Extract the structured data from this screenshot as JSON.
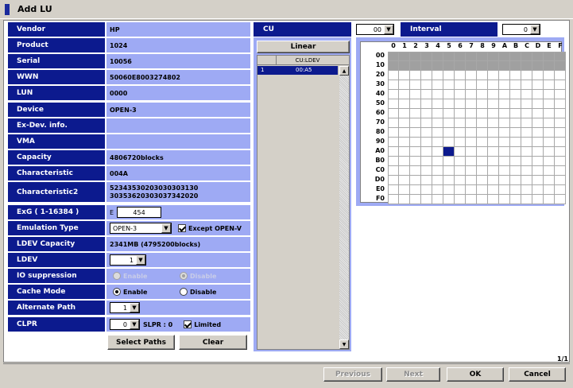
{
  "window": {
    "title": "Add LU"
  },
  "properties": [
    {
      "label": "Vendor",
      "value": "HP"
    },
    {
      "label": "Product",
      "value": "1024"
    },
    {
      "label": "Serial",
      "value": "10056"
    },
    {
      "label": "WWN",
      "value": "50060E8003274802"
    },
    {
      "label": "LUN",
      "value": "0000"
    },
    {
      "label": "Device",
      "value": "OPEN-3"
    },
    {
      "label": "Ex-Dev. info.",
      "value": ""
    },
    {
      "label": "VMA",
      "value": ""
    },
    {
      "label": "Capacity",
      "value": "4806720blocks"
    },
    {
      "label": "Characteristic",
      "value": "004A"
    },
    {
      "label": "Characteristic2",
      "value_lines": [
        "52343530203030303130",
        "30353620303037342020"
      ]
    }
  ],
  "exg": {
    "label": "ExG ( 1-16384 )",
    "prefix": "E",
    "value": "454"
  },
  "emulation": {
    "label": "Emulation Type",
    "selected": "OPEN-3",
    "except_label": "Except OPEN-V",
    "except_checked": true
  },
  "ldev_capacity": {
    "label": "LDEV Capacity",
    "value": "2341MB (4795200blocks)"
  },
  "ldev": {
    "label": "LDEV",
    "selected": "1"
  },
  "io_suppression": {
    "label": "IO suppression",
    "enable_label": "Enable",
    "disable_label": "Disable",
    "selected": "Disable",
    "disabled": true
  },
  "cache_mode": {
    "label": "Cache Mode",
    "enable_label": "Enable",
    "disable_label": "Disable",
    "selected": "Enable"
  },
  "alternate_path": {
    "label": "Alternate Path",
    "selected": "1"
  },
  "clpr": {
    "label": "CLPR",
    "selected": "0",
    "slpr_text": "SLPR : 0",
    "limited_label": "Limited",
    "limited_checked": true
  },
  "buttons": {
    "select_paths": "Select Paths",
    "clear": "Clear",
    "previous": "Previous",
    "next": "Next",
    "ok": "OK",
    "cancel": "Cancel"
  },
  "cu_header": {
    "label": "CU",
    "selected": "00"
  },
  "interval": {
    "label": "Interval",
    "selected": "0"
  },
  "cu_list": {
    "mode_button": "Linear",
    "header": "CU:LDEV",
    "rows": [
      {
        "index": "1",
        "cu_ldev": "00:A5"
      }
    ]
  },
  "grid": {
    "columns": [
      "0",
      "1",
      "2",
      "3",
      "4",
      "5",
      "6",
      "7",
      "8",
      "9",
      "A",
      "B",
      "C",
      "D",
      "E",
      "F"
    ],
    "rows": [
      "00",
      "10",
      "20",
      "30",
      "40",
      "50",
      "60",
      "70",
      "80",
      "90",
      "A0",
      "B0",
      "C0",
      "D0",
      "E0",
      "F0"
    ],
    "unavailable_rows": [
      "00",
      "10"
    ],
    "selected": {
      "row": "A0",
      "col": "5"
    },
    "colors": {
      "unavailable": "#a0a0a0",
      "selected": "#0c1a8e",
      "free": "#ffffff"
    }
  },
  "page_indicator": "1/1",
  "colors": {
    "label_bg": "#0c1a8e",
    "value_bg": "#9eaaf4",
    "window_bg": "#d4d0c8"
  }
}
